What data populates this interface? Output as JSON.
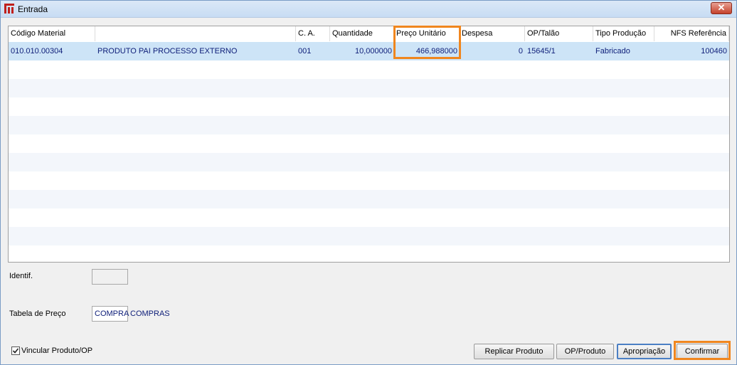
{
  "window": {
    "title": "Entrada",
    "close_icon": "close-icon"
  },
  "grid": {
    "columns": [
      "Código Material",
      "",
      "C. A.",
      "Quantidade",
      "Preço Unitário",
      "Despesa",
      "OP/Talão",
      "Tipo Produção",
      "NFS Referência"
    ],
    "rows": [
      [
        "010.010.00304",
        "PRODUTO PAI PROCESSO EXTERNO",
        "001",
        "10,000000",
        "466,988000",
        "0",
        "15645/1",
        "Fabricado",
        "100460"
      ]
    ]
  },
  "form": {
    "identif_label": "Identif.",
    "identif_value": "",
    "tabela_label": "Tabela de Preço",
    "tabela_code": "COMPRA",
    "tabela_desc": "COMPRAS",
    "vincular_label": "Vincular Produto/OP",
    "vincular_checked": true
  },
  "buttons": {
    "replicar": "Replicar Produto",
    "op_produto": "OP/Produto",
    "apropriacao": "Apropriação",
    "confirmar": "Confirmar"
  },
  "highlight_color": "#f0861e"
}
